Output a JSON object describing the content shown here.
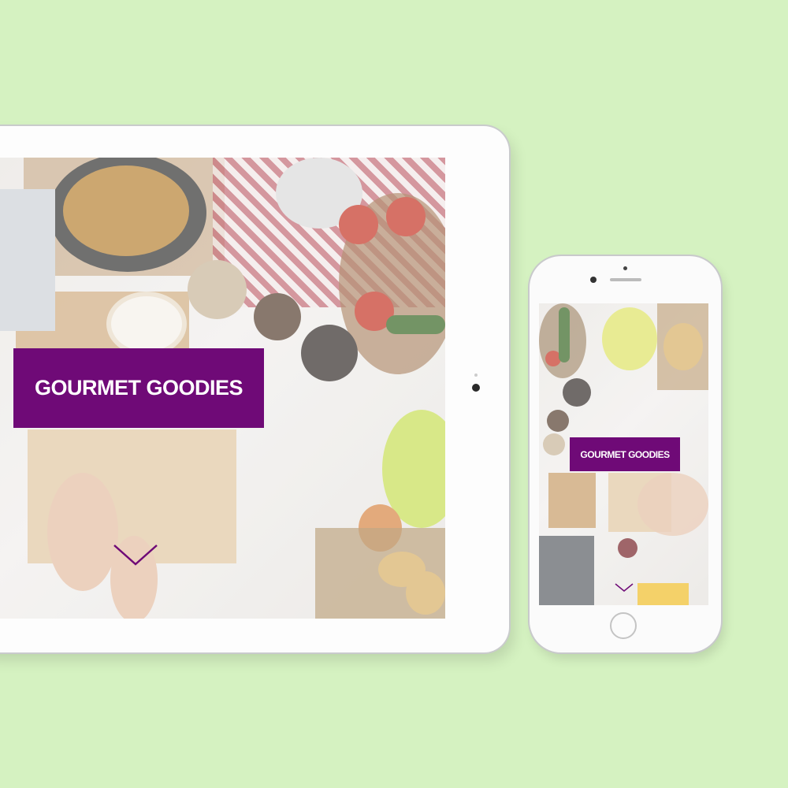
{
  "site": {
    "hero_title": "GOURMET GOODIES",
    "scroll_icon": "chevron-down-icon"
  },
  "colors": {
    "background": "#d5f2c1",
    "brand_purple": "#6f0a77"
  }
}
